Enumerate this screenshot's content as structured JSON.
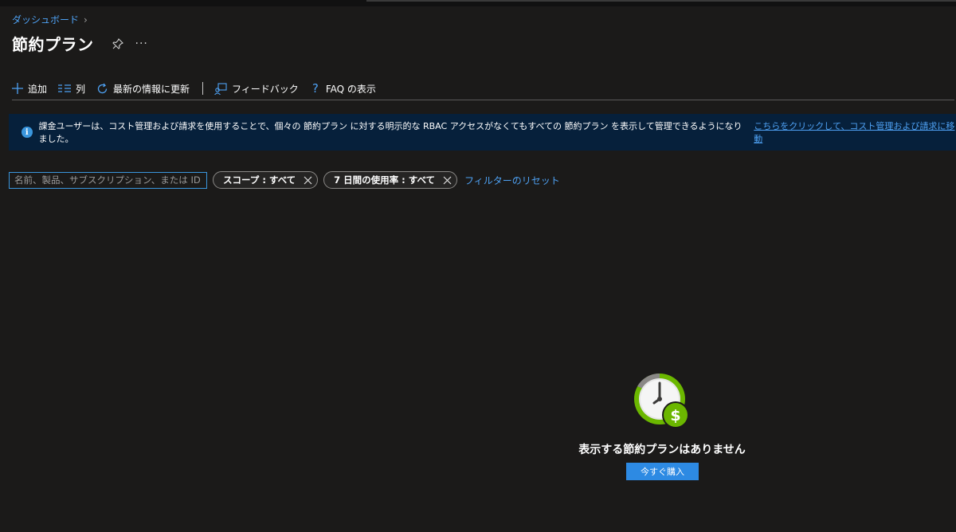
{
  "breadcrumb": {
    "label": "ダッシュボード"
  },
  "page": {
    "title": "節約プラン"
  },
  "toolbar": {
    "add_label": "追加",
    "columns_label": "列",
    "refresh_label": "最新の情報に更新",
    "feedback_label": "フィードバック",
    "faq_label": "FAQ の表示"
  },
  "banner": {
    "text": "課金ユーザーは、コスト管理および請求を使用することで、個々の 節約プラン に対する明示的な RBAC アクセスがなくてもすべての 節約プラン を表示して管理できるようになりました。",
    "link": "こちらをクリックして、コスト管理および請求に移動"
  },
  "filters": {
    "search_placeholder": "名前、製品、サブスクリプション、または ID でフィルター処理",
    "scope_pill": "スコープ : すべて",
    "usage_pill": "7 日間の使用率 : すべて",
    "reset_label": "フィルターのリセット"
  },
  "empty_state": {
    "message": "表示する節約プランはありません",
    "buy_label": "今すぐ購入"
  },
  "colors": {
    "background": "#1b1a19",
    "accent": "#4ea1f3",
    "banner": "#06203b",
    "button": "#2d8ae3",
    "green": "#6bb700"
  }
}
